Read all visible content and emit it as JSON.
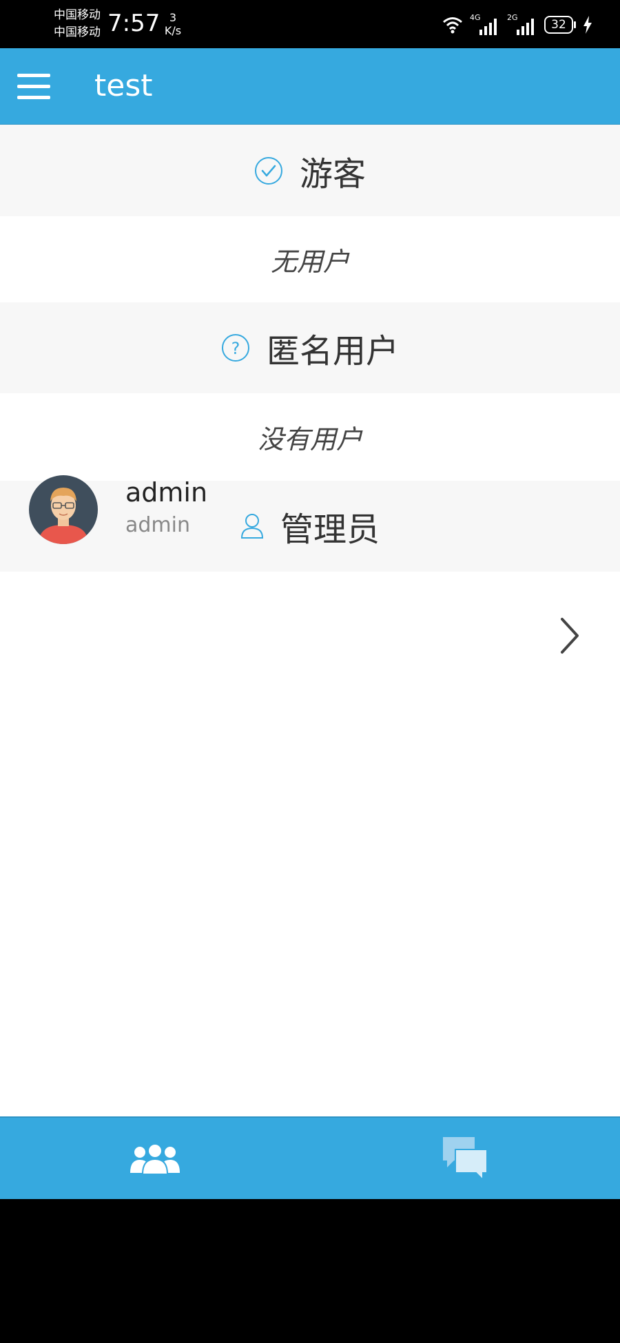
{
  "status_bar": {
    "carrier_1": "中国移动",
    "carrier_2": "中国移动",
    "time": "7:57",
    "speed_value": "3",
    "speed_unit": "K/s",
    "network_1": "4G",
    "network_2": "2G",
    "battery": "32"
  },
  "app_bar": {
    "title": "test",
    "menu_icon": "hamburger-menu-icon"
  },
  "groups": [
    {
      "title": "游客",
      "icon": "check-circle-icon",
      "empty_text": "无用户"
    },
    {
      "title": "匿名用户",
      "icon": "question-circle-icon",
      "empty_text": "没有用户"
    },
    {
      "title": "管理员",
      "icon": "user-icon"
    }
  ],
  "users": [
    {
      "name": "admin",
      "subtitle": "admin",
      "avatar": "avatar-man-glasses"
    }
  ],
  "bottom_nav": {
    "items": [
      {
        "icon": "users-group-icon"
      },
      {
        "icon": "chat-bubbles-icon"
      }
    ]
  },
  "colors": {
    "accent": "#36a9df",
    "header_bg": "#f7f7f7",
    "text": "#333333",
    "icon_line": "#36a9df"
  }
}
